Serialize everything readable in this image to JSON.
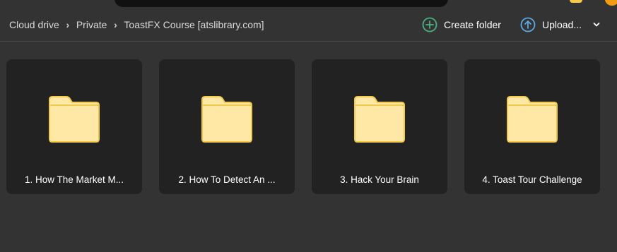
{
  "breadcrumb": {
    "items": [
      "Cloud drive",
      "Private",
      "ToastFX Course [atslibrary.com]"
    ],
    "separator": "›"
  },
  "actions": {
    "create_folder_label": "Create folder",
    "upload_label": "Upload..."
  },
  "folders": [
    {
      "name": "1. How The Market M..."
    },
    {
      "name": "2. How To Detect An ..."
    },
    {
      "name": "3. Hack Your Brain"
    },
    {
      "name": "4. Toast Tour Challenge"
    }
  ],
  "colors": {
    "background": "#333333",
    "card": "#222222",
    "folder_body": "#ffe8a5",
    "folder_outline": "#f2c94c",
    "create_icon": "#4caf82",
    "upload_icon": "#5aa9e6"
  },
  "icons": {
    "create_folder": "plus-circle-icon",
    "upload": "arrow-up-circle-icon",
    "dropdown": "chevron-down-icon",
    "folder": "folder-icon"
  }
}
